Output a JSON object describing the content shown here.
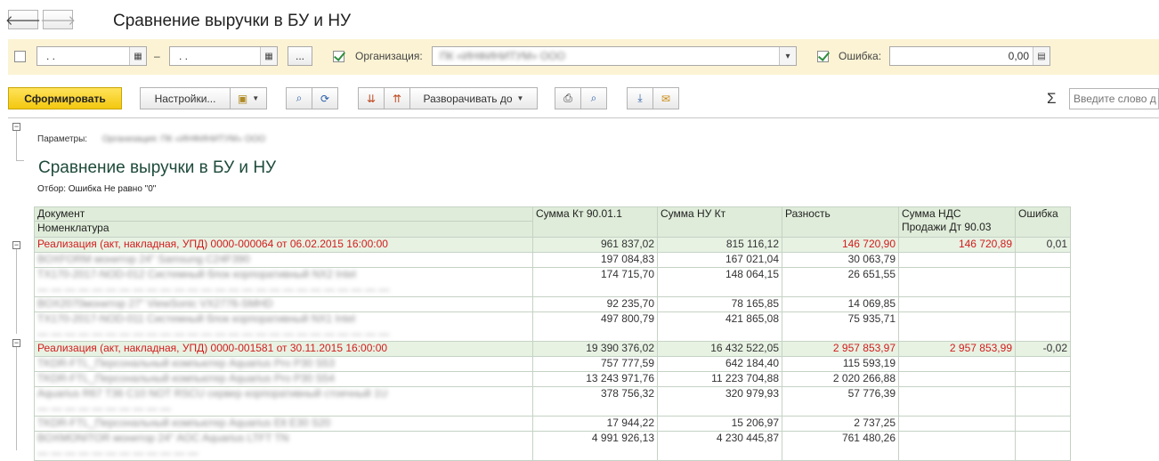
{
  "window": {
    "title": "Сравнение выручки в БУ и НУ",
    "back_icon": "arrow-left",
    "forward_icon": "arrow-right"
  },
  "filters": {
    "period_from": ". .",
    "period_to": ". .",
    "dash": "–",
    "more_button": "...",
    "organization_label": "Организация:",
    "organization_value": "ПК «ИНФИНИТУМ» ООО",
    "error_label": "Ошибка:",
    "error_value": "0,00"
  },
  "toolbar": {
    "generate": "Сформировать",
    "settings": "Настройки...",
    "expand_to": "Разворачивать до",
    "search_placeholder": "Введите слово д"
  },
  "report": {
    "params_label": "Параметры:",
    "params_value": "Организация: ПК «ИНФИНИТУМ» ООО",
    "title": "Сравнение выручки в БУ и НУ",
    "selection": "Отбор: Ошибка Не равно \"0\"",
    "columns": {
      "doc": "Документ",
      "nomenclature": "Номенклатура",
      "kt": "Сумма Кт 90.01.1",
      "nu": "Сумма НУ Кт",
      "diff": "Разность",
      "vat_line1": "Сумма НДС",
      "vat_line2": "Продажи Дт 90.03",
      "error": "Ошибка"
    },
    "groups": [
      {
        "doc": "Реализация (акт, накладная, УПД) 0000-000064 от 06.02.2015 16:00:00",
        "kt": "961 837,02",
        "nu": "815 116,12",
        "diff": "146 720,90",
        "vat": "146 720,89",
        "error": "0,01",
        "rows": [
          {
            "name": "BOXFORM монитор 24\" Samsung C24F390",
            "kt": "197 084,83",
            "nu": "167 021,04",
            "diff": "30 063,79"
          },
          {
            "name": "TX170-2017-NOD-012 Системный блок корпоративный NX2 Intel",
            "kt": "174 715,70",
            "nu": "148 064,15",
            "diff": "26 651,55"
          },
          {
            "name": "BOX2070монитор 27\" ViewSonic VX2776-SMHD",
            "kt": "92 235,70",
            "nu": "78 165,85",
            "diff": "14 069,85"
          },
          {
            "name": "TX170-2017-NOD-011 Системный блок корпоративный NX1 Intel",
            "kt": "497 800,79",
            "nu": "421 865,08",
            "diff": "75 935,71"
          }
        ]
      },
      {
        "doc": "Реализация (акт, накладная, УПД) 0000-001581 от 30.11.2015 16:00:00",
        "kt": "19 390 376,02",
        "nu": "16 432 522,05",
        "diff": "2 957 853,97",
        "vat": "2 957 853,99",
        "error": "-0,02",
        "rows": [
          {
            "name": "TKDR-FTL_Персональный компьютер Aquarius Pro P30 S53",
            "kt": "757 777,59",
            "nu": "642 184,40",
            "diff": "115 593,19"
          },
          {
            "name": "TKDR-FTL_Персональный компьютер Aquarius Pro P30 S54",
            "kt": "13 243 971,76",
            "nu": "11 223 704,88",
            "diff": "2 020 266,88"
          },
          {
            "name": "Aquarius R67 T36 C10 NOT RSCU сервер корпоративный стоечный 1U",
            "kt": "378 756,32",
            "nu": "320 979,93",
            "diff": "57 776,39"
          },
          {
            "name": "TKDR-FTL_Персональный компьютер Aquarius Elt E30 S20",
            "kt": "17 944,22",
            "nu": "15 206,97",
            "diff": "2 737,25"
          },
          {
            "name": "BOXMONITOR монитор 24\" AOC Aquarius LTFT TN",
            "kt": "4 991 926,13",
            "nu": "4 230 445,87",
            "diff": "761 480,26"
          }
        ]
      }
    ]
  },
  "colors": {
    "accent": "#f3c80f",
    "red": "#d21c1c",
    "header_bg": "#dfecd9",
    "filter_bg": "#fbf3d4"
  }
}
